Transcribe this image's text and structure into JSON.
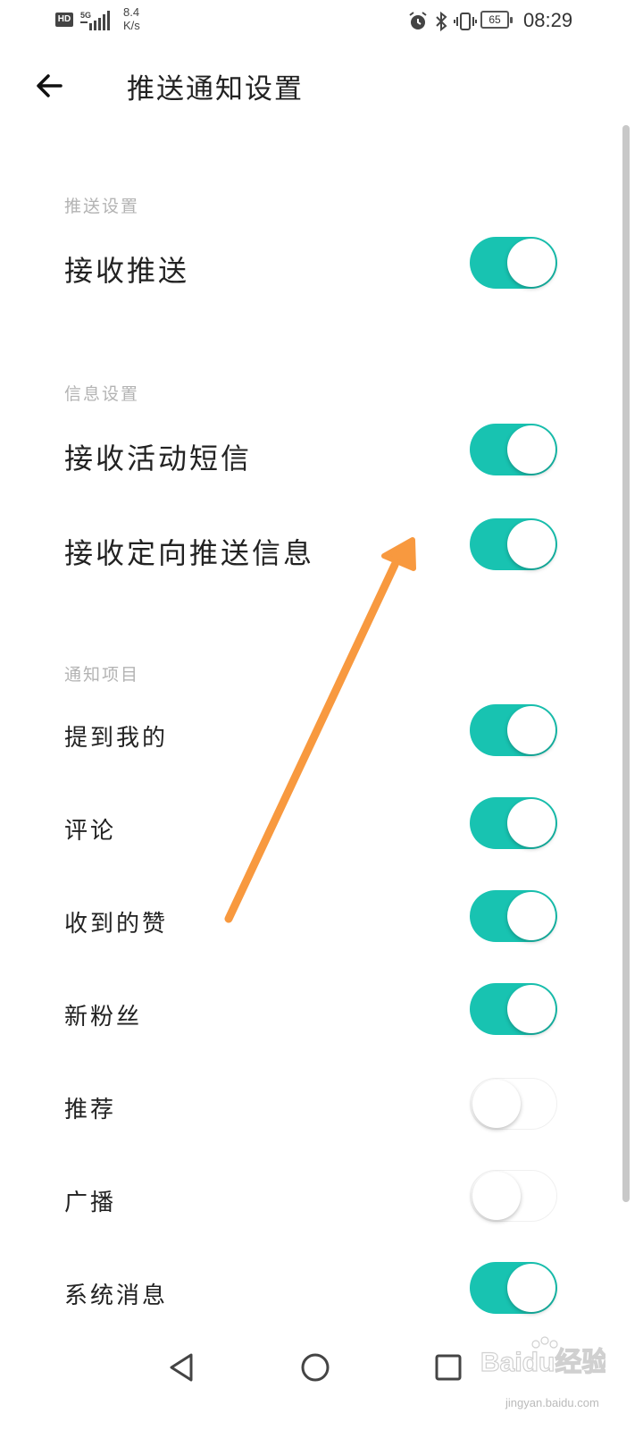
{
  "status_bar": {
    "hd_label": "HD",
    "network": "5G",
    "speed_value": "8.4",
    "speed_unit": "K/s",
    "battery": "65",
    "time": "08:29"
  },
  "header": {
    "title": "推送通知设置",
    "back_icon": "back-arrow-icon"
  },
  "sections": {
    "push": {
      "title": "推送设置",
      "items": [
        {
          "label": "接收推送",
          "on": true
        }
      ]
    },
    "info": {
      "title": "信息设置",
      "items": [
        {
          "label": "接收活动短信",
          "on": true
        },
        {
          "label": "接收定向推送信息",
          "on": true
        }
      ]
    },
    "notify": {
      "title": "通知项目",
      "items": [
        {
          "label": "提到我的",
          "on": true
        },
        {
          "label": "评论",
          "on": true
        },
        {
          "label": "收到的赞",
          "on": true
        },
        {
          "label": "新粉丝",
          "on": true
        },
        {
          "label": "推荐",
          "on": false
        },
        {
          "label": "广播",
          "on": false
        },
        {
          "label": "系统消息",
          "on": true
        }
      ]
    }
  },
  "colors": {
    "accent": "#18c3b1",
    "annotation_arrow": "#f8993f"
  },
  "nav_bar": {
    "back_icon": "triangle-back-icon",
    "home_icon": "circle-home-icon",
    "recents_icon": "square-recents-icon"
  },
  "watermark": {
    "main": "Baidu经验",
    "sub": "jingyan.baidu.com"
  }
}
